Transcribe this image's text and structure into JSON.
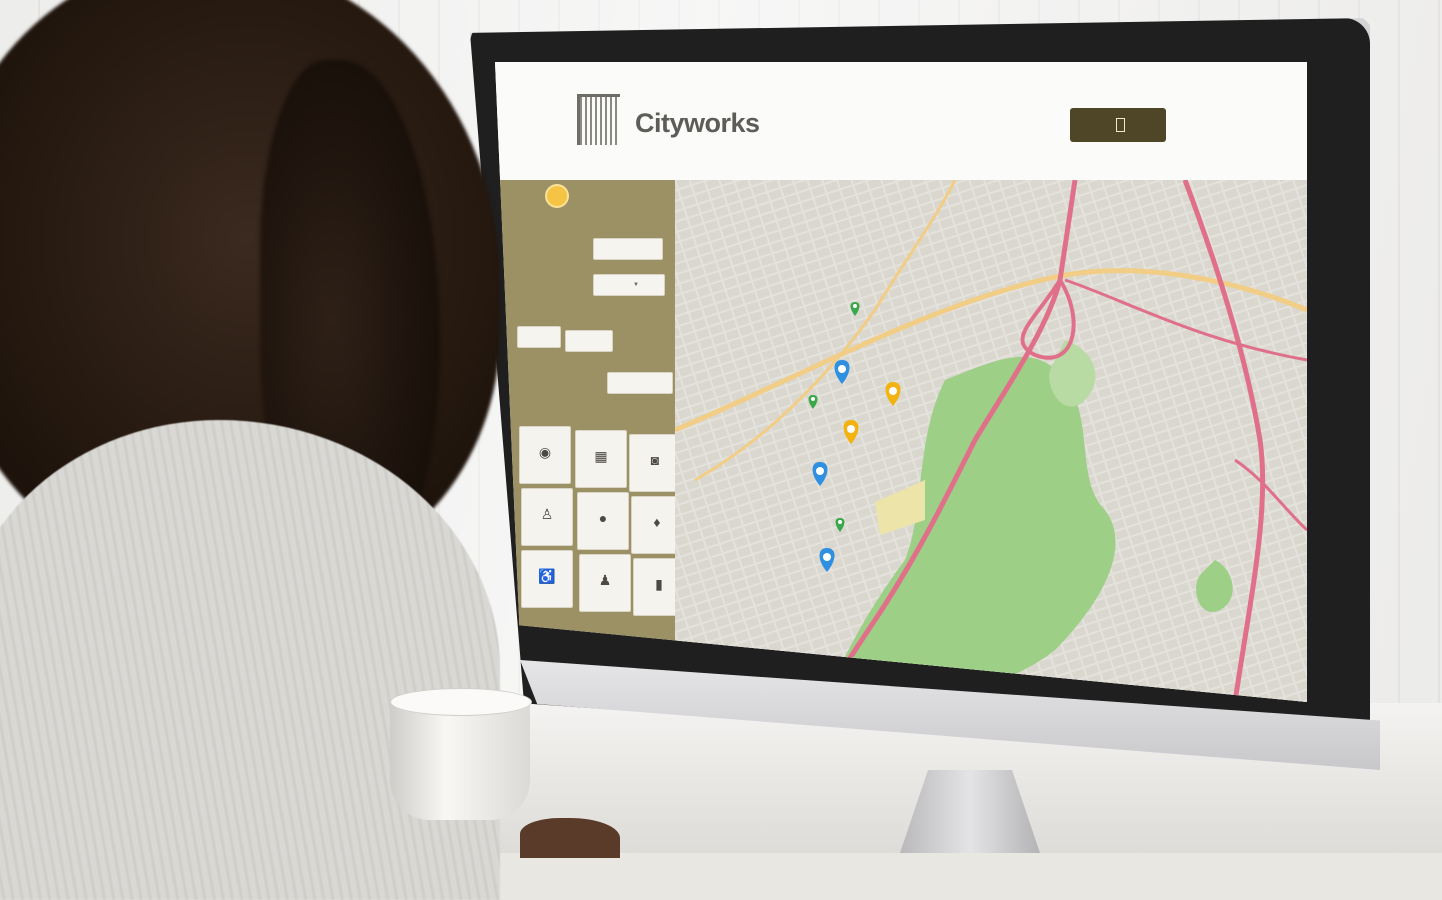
{
  "app": {
    "brand": "Cityworks",
    "logo_caption": "",
    "nav": {
      "link_1": "",
      "link_2": "",
      "cta": ""
    }
  },
  "sidebar": {
    "toggle_label": "",
    "fields": [
      {
        "label": "",
        "button": ""
      },
      {
        "label": "",
        "select_value": ""
      },
      {
        "label": "",
        "buttons": [
          "",
          ""
        ]
      },
      {
        "label": "",
        "button": ""
      }
    ],
    "grid_label": "",
    "tiles": [
      {
        "icon": "gauge-icon",
        "glyph": "◉",
        "label": ""
      },
      {
        "icon": "building-icon",
        "glyph": "▦",
        "label": ""
      },
      {
        "icon": "camera-icon",
        "glyph": "◙",
        "label": ""
      },
      {
        "icon": "person-icon",
        "glyph": "♙",
        "label": ""
      },
      {
        "icon": "drop-icon",
        "glyph": "●",
        "label": ""
      },
      {
        "icon": "pin-icon",
        "glyph": "♦",
        "label": ""
      },
      {
        "icon": "wheelchair-icon",
        "glyph": "♿",
        "label": ""
      },
      {
        "icon": "worker-icon",
        "glyph": "♟",
        "label": ""
      },
      {
        "icon": "document-icon",
        "glyph": "▮",
        "label": ""
      }
    ]
  },
  "map": {
    "markers": [
      {
        "type": "blue-cluster",
        "icon": "map-pin-icon",
        "color": "#2f8fe0"
      },
      {
        "type": "blue-cluster",
        "icon": "map-pin-icon",
        "color": "#2f8fe0"
      },
      {
        "type": "blue-cluster",
        "icon": "map-pin-icon",
        "color": "#2f8fe0"
      },
      {
        "type": "yellow-cluster",
        "icon": "map-pin-icon",
        "color": "#f2b20f"
      },
      {
        "type": "yellow-cluster",
        "icon": "map-pin-icon",
        "color": "#f2b20f"
      },
      {
        "type": "green-pin",
        "icon": "map-pin-icon",
        "color": "#3aa84a"
      },
      {
        "type": "green-pin",
        "icon": "map-pin-icon",
        "color": "#3aa84a"
      },
      {
        "type": "green-pin",
        "icon": "map-pin-icon",
        "color": "#3aa84a"
      }
    ]
  },
  "colors": {
    "sidebar": "#9b9165",
    "cta": "#4f4627",
    "park": "#9dcf86",
    "road_major": "#e0708a",
    "road_secondary": "#f1cd85"
  }
}
